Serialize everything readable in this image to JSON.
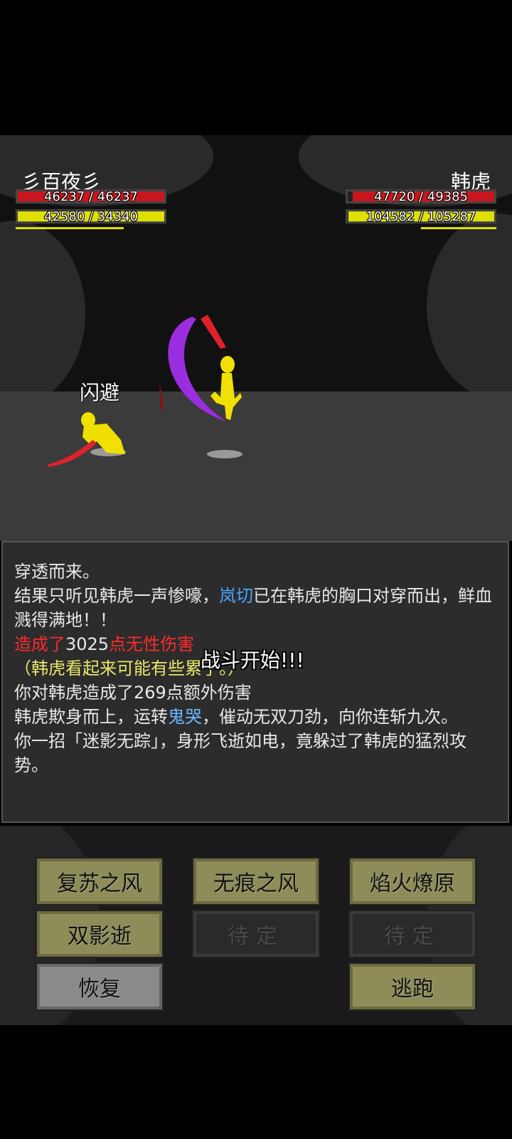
{
  "player": {
    "name": "彡百夜彡",
    "hp_text": "46237 / 46237",
    "hp_fraction": 1.0,
    "mp_text": "42580 / 34340",
    "mp_fraction": 1.0
  },
  "enemy": {
    "name": "韩虎",
    "hp_text": "47720 / 49385",
    "hp_fraction": 0.966,
    "mp_text": "104582 / 105287",
    "mp_fraction": 0.993
  },
  "battle": {
    "dodge_label": "闪避",
    "center_message": "战斗开始!!!"
  },
  "log": {
    "line1": "穿透而来。",
    "line2a": "结果只听见韩虎一声惨嚎，",
    "line2b": "岚切",
    "line2c": "已在韩虎的胸口对穿而出，鲜血溅得满地！！",
    "line3a": "造成了",
    "line3b": "3025",
    "line3c": "点无性伤害",
    "line4": "（韩虎看起来可能有些累了。）",
    "line5": "你对韩虎造成了269点额外伤害",
    "line6a": "韩虎欺身而上，运转",
    "line6b": "鬼哭",
    "line6c": "，催动无双刀劲，向你连斩九次。",
    "line7": "你一招「迷影无踪」，身形飞逝如电，竟躲过了韩虎的猛烈攻势。"
  },
  "skills": {
    "s1": "复苏之风",
    "s2": "无痕之风",
    "s3": "焰火燎原",
    "s4": "双影逝",
    "s5": "待定",
    "s6": "待定",
    "recover": "恢复",
    "flee": "逃跑"
  },
  "colors": {
    "hp": "#c8161e",
    "mp": "#e0e000",
    "skill_button": "#8e8c58",
    "locked_button": "#2a2a2a",
    "link_blue": "#4aa3ff",
    "damage_red": "#ff2a2a"
  }
}
